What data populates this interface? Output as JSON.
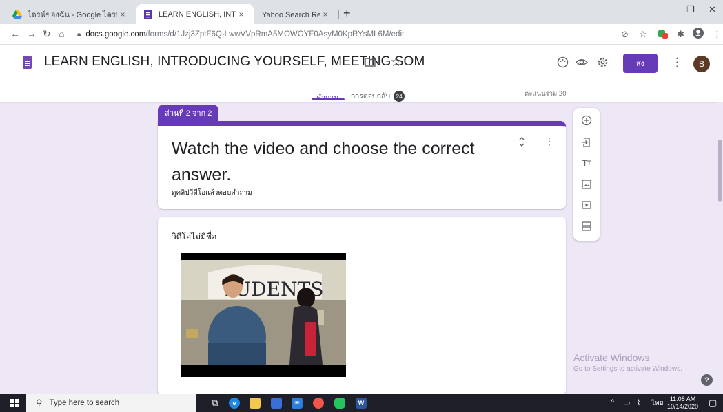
{
  "browser": {
    "tabs": [
      {
        "title": "ไดรฟ์ของฉัน - Google ไดรฟ์",
        "active": false
      },
      {
        "title": "LEARN ENGLISH, INTRODUCING",
        "active": true
      },
      {
        "title": "Yahoo Search Results - การค้นหาเว็บ",
        "active": false
      }
    ],
    "close_glyph": "×",
    "new_tab_glyph": "+",
    "window_controls": [
      "–",
      "❐",
      "✕"
    ],
    "url_host": "docs.google.com",
    "url_path": "/forms/d/1Jzj3ZptF6Q-LwwVVpRmA5MOWOYF0AsyM0KpRYsML6M/edit"
  },
  "form_header": {
    "title": "LEARN ENGLISH, INTRODUCING YOURSELF, MEETING SOM",
    "send_label": "ส่ง",
    "avatar_letter": "B",
    "tabs": {
      "questions": "คำถาม",
      "responses": "การตอบกลับ",
      "responses_count": "24"
    },
    "total_points": "คะแนนรวม 20"
  },
  "section": {
    "badge": "ส่วนที่ 2 จาก 2",
    "title": "Watch the video and choose the correct answer.",
    "description": "ดูคลิปวีดีโอแล้วตอบคำถาม"
  },
  "video_item": {
    "title": "วิดีโอไม่มีชื่อ",
    "banner_text": "TUDENTS"
  },
  "watermark": {
    "line1": "Activate Windows",
    "line2": "Go to Settings to activate Windows."
  },
  "help_glyph": "?",
  "taskbar": {
    "search_placeholder": "Type here to search",
    "tray_lang": "ไทย",
    "time": "11:08 AM",
    "date": "10/14/2020"
  },
  "colors": {
    "accent": "#673ab7",
    "background": "#ede7f6"
  }
}
